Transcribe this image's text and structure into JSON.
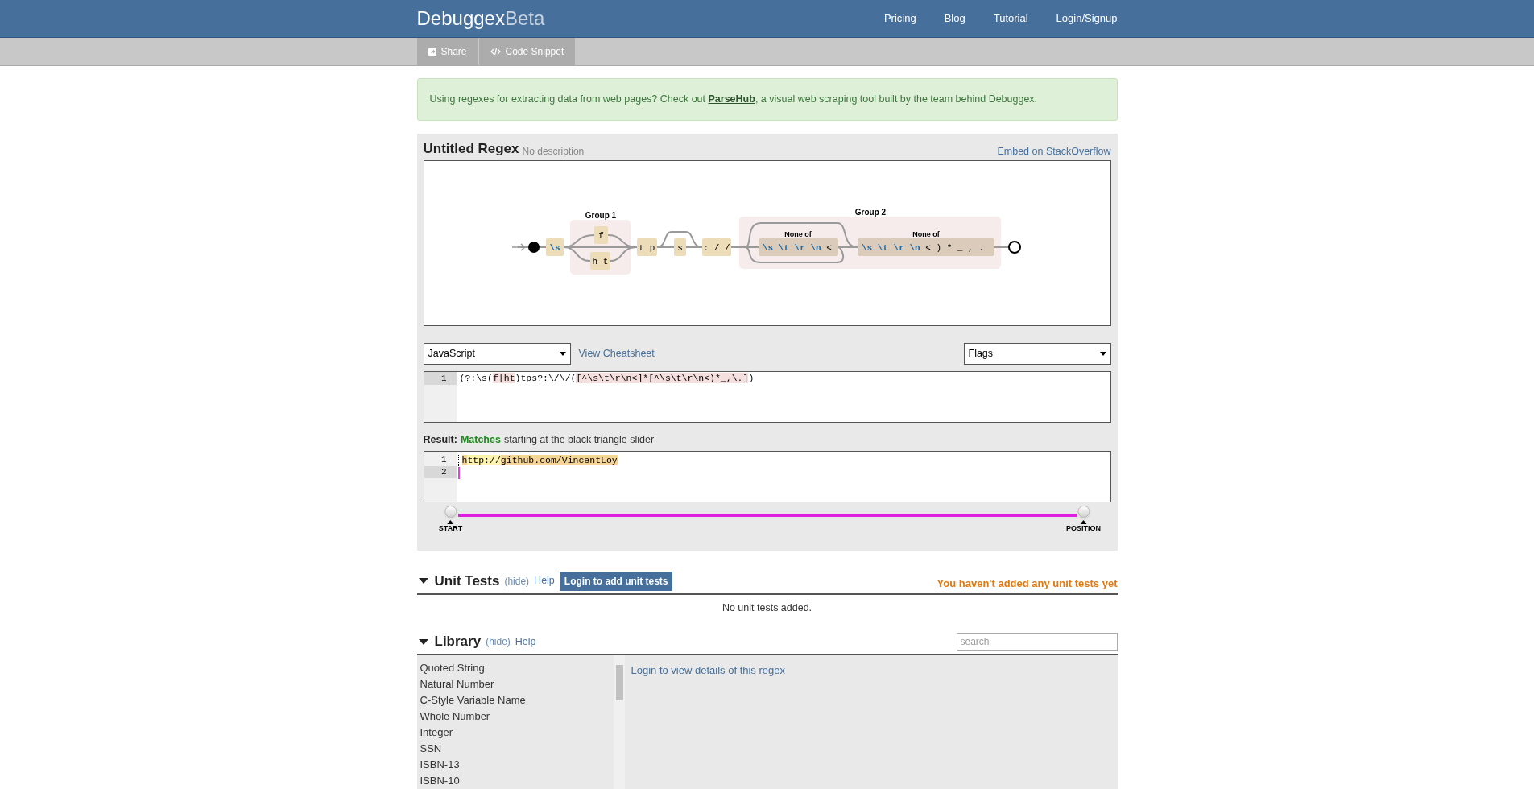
{
  "header": {
    "logo": "Debuggex",
    "logo_suffix": "Beta",
    "nav": [
      "Pricing",
      "Blog",
      "Tutorial",
      "Login/Signup"
    ]
  },
  "toolbar": [
    {
      "label": "Share",
      "kind": "share"
    },
    {
      "label": "Code Snippet",
      "kind": "code"
    }
  ],
  "alert": "Using regexes for extracting data from web pages? Check out **ParseHub**, a visual web scraping tool built by the team behind Debuggex.",
  "regex": {
    "title": "Untitled Regex",
    "description": "No description",
    "embed_link": "Embed on StackOverflow",
    "diagram": {
      "group_labels": [
        "Group 1",
        "Group 2"
      ],
      "literals": [
        "\\s",
        "f",
        "h t",
        "t p",
        "s",
        ": / /"
      ],
      "classes": [
        {
          "label": "None of",
          "tokens": [
            {
              "text": "\\s",
              "kind": "escape"
            },
            {
              "text": "\\t",
              "kind": "escape"
            },
            {
              "text": "\\r",
              "kind": "escape"
            },
            {
              "text": "\\n",
              "kind": "escape"
            },
            {
              "text": "<",
              "kind": "char"
            }
          ]
        },
        {
          "label": "None of",
          "tokens": [
            {
              "text": "\\s",
              "kind": "escape"
            },
            {
              "text": "\\t",
              "kind": "escape"
            },
            {
              "text": "\\r",
              "kind": "escape"
            },
            {
              "text": "\\n",
              "kind": "escape"
            },
            {
              "text": "<",
              "kind": "char"
            },
            {
              "text": ")",
              "kind": "char"
            },
            {
              "text": "*",
              "kind": "char"
            },
            {
              "text": "_",
              "kind": "char"
            },
            {
              "text": ",",
              "kind": "char"
            },
            {
              "text": ".",
              "kind": "char"
            }
          ]
        }
      ]
    },
    "flavor": "JavaScript",
    "cheatsheet": "View Cheatsheet",
    "flags": "Flags",
    "code": {
      "line_number": "1",
      "segments": [
        {
          "text": "(?:",
          "highlight": false
        },
        {
          "text": "\\s",
          "highlight": false
        },
        {
          "text": "(",
          "highlight": false
        },
        {
          "text": "f|ht",
          "highlight": true
        },
        {
          "text": ")tps?:\\/\\/(",
          "highlight": false
        },
        {
          "text": "[^\\s\\t\\r\\n<]*[^\\s\\t\\r\\n<)*_,\\.]",
          "highlight": true
        },
        {
          "text": ")",
          "highlight": false
        }
      ]
    },
    "result": {
      "label": "Result:",
      "status": "Matches",
      "note": "starting at the black triangle slider"
    },
    "test_text": {
      "line_numbers": [
        "1",
        "2"
      ],
      "segments": [
        {
          "text": "h",
          "kind": "match"
        },
        {
          "text": "ttp://",
          "kind": "group"
        },
        {
          "text": "github.com/VincentLoy",
          "kind": "match"
        }
      ]
    },
    "slider": {
      "start": {
        "label": "START",
        "level": 0
      },
      "position": {
        "label": "POSITION",
        "level": 1
      }
    }
  },
  "unit_tests": {
    "title": "Unit Tests",
    "hide": "(hide)",
    "help": "Help",
    "button": "Login to add unit tests",
    "warning": "You haven't added any unit tests yet",
    "empty": "No unit tests added."
  },
  "library": {
    "title": "Library",
    "hide": "(hide)",
    "help": "Help",
    "search": {
      "placeholder": "search"
    },
    "items": [
      "Quoted String",
      "Natural Number",
      "C-Style Variable Name",
      "Whole Number",
      "Integer",
      "SSN",
      "ISBN-13",
      "ISBN-10"
    ],
    "detail": "Login to view details of this regex"
  }
}
